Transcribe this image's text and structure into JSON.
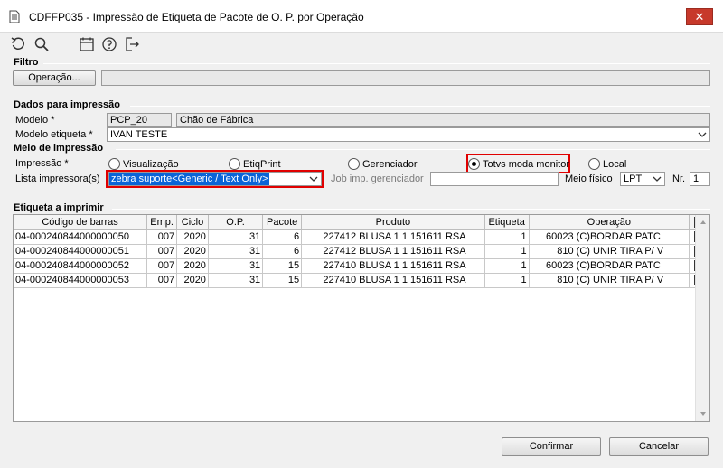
{
  "window": {
    "title": "CDFFP035 - Impressão de Etiqueta de Pacote de O. P. por Operação",
    "close_label": "✕"
  },
  "toolbar": {
    "icons": [
      "undo-icon",
      "search-icon",
      "calendar-icon",
      "help-icon",
      "exit-icon"
    ]
  },
  "filtro": {
    "label": "Filtro",
    "operacao_button": "Operação...",
    "operacao_value": ""
  },
  "dados": {
    "label": "Dados para impressão",
    "modelo_label": "Modelo *",
    "modelo_code": "PCP_20",
    "modelo_desc": "Chão de Fábrica",
    "modelo_etiqueta_label": "Modelo etiqueta *",
    "modelo_etiqueta_value": "IVAN TESTE"
  },
  "meio": {
    "label": "Meio de impressão",
    "impressao_label": "Impressão *",
    "options": [
      "Visualização",
      "EtiqPrint",
      "Gerenciador",
      "Totvs moda monitor",
      "Local"
    ],
    "selected": "Totvs moda monitor",
    "lista_label": "Lista impressora(s)",
    "lista_value": "zebra suporte<Generic / Text Only>",
    "job_label": "Job imp. gerenciador",
    "job_value": "",
    "meio_fisico_label": "Meio físico",
    "meio_fisico_value": "LPT",
    "nr_label": "Nr.",
    "nr_value": "1"
  },
  "etiqueta": {
    "label": "Etiqueta a imprimir",
    "columns": [
      "Código de barras",
      "Emp.",
      "Ciclo",
      "O.P.",
      "Pacote",
      "Produto",
      "Etiqueta",
      "Operação"
    ],
    "rows": [
      {
        "codigo": "04-000240844000000050",
        "emp": "007",
        "ciclo": "2020",
        "op": "31",
        "pacote": "6",
        "produto_cod": "227412",
        "produto_desc": "BLUSA 1 1 151611 RSA",
        "etiqueta": "1",
        "operacao_cod": "60023",
        "operacao_desc": "(C)BORDAR PATC",
        "checked": true
      },
      {
        "codigo": "04-000240844000000051",
        "emp": "007",
        "ciclo": "2020",
        "op": "31",
        "pacote": "6",
        "produto_cod": "227412",
        "produto_desc": "BLUSA 1 1 151611 RSA",
        "etiqueta": "1",
        "operacao_cod": "810",
        "operacao_desc": "(C) UNIR TIRA P/ V",
        "checked": true
      },
      {
        "codigo": "04-000240844000000052",
        "emp": "007",
        "ciclo": "2020",
        "op": "31",
        "pacote": "15",
        "produto_cod": "227410",
        "produto_desc": "BLUSA 1 1 151611 RSA",
        "etiqueta": "1",
        "operacao_cod": "60023",
        "operacao_desc": "(C)BORDAR PATC",
        "checked": true
      },
      {
        "codigo": "04-000240844000000053",
        "emp": "007",
        "ciclo": "2020",
        "op": "31",
        "pacote": "15",
        "produto_cod": "227410",
        "produto_desc": "BLUSA 1 1 151611 RSA",
        "etiqueta": "1",
        "operacao_cod": "810",
        "operacao_desc": "(C) UNIR TIRA P/ V",
        "checked": true
      }
    ]
  },
  "footer": {
    "confirmar": "Confirmar",
    "cancelar": "Cancelar"
  },
  "colors": {
    "highlight": "#0a64d7",
    "alert_outline": "#e00000",
    "close_button": "#c7392b"
  }
}
